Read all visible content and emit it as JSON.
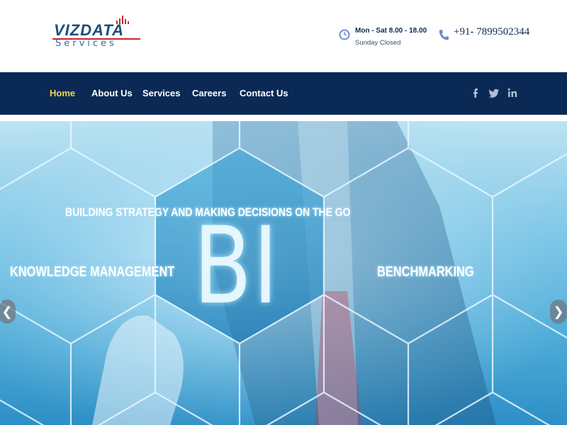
{
  "logo": {
    "main": "VIZDATA",
    "sub": "Services"
  },
  "header": {
    "hours": "Mon - Sat 8.00 - 18.00",
    "closed": "Sunday Closed",
    "phone": "+91- 7899502344"
  },
  "nav": {
    "items": [
      {
        "label": "Home",
        "active": true
      },
      {
        "label": "About Us",
        "active": false
      },
      {
        "label": "Services",
        "active": false
      },
      {
        "label": "Careers",
        "active": false
      },
      {
        "label": "Contact Us",
        "active": false
      }
    ],
    "social": [
      "facebook-icon",
      "twitter-icon",
      "linkedin-icon"
    ]
  },
  "hero": {
    "strategy": "BUILDING STRATEGY AND MAKING DECISIONS ON THE GO",
    "knowledge": "KNOWLEDGE MANAGEMENT",
    "bi": "BI",
    "benchmarking": "BENCHMARKING",
    "prev": "❮",
    "next": "❯"
  },
  "colors": {
    "nav_bg": "#0a2a55",
    "nav_active": "#f5d64a",
    "brand": "#1a4e7c",
    "accent_red": "#c9262c"
  }
}
